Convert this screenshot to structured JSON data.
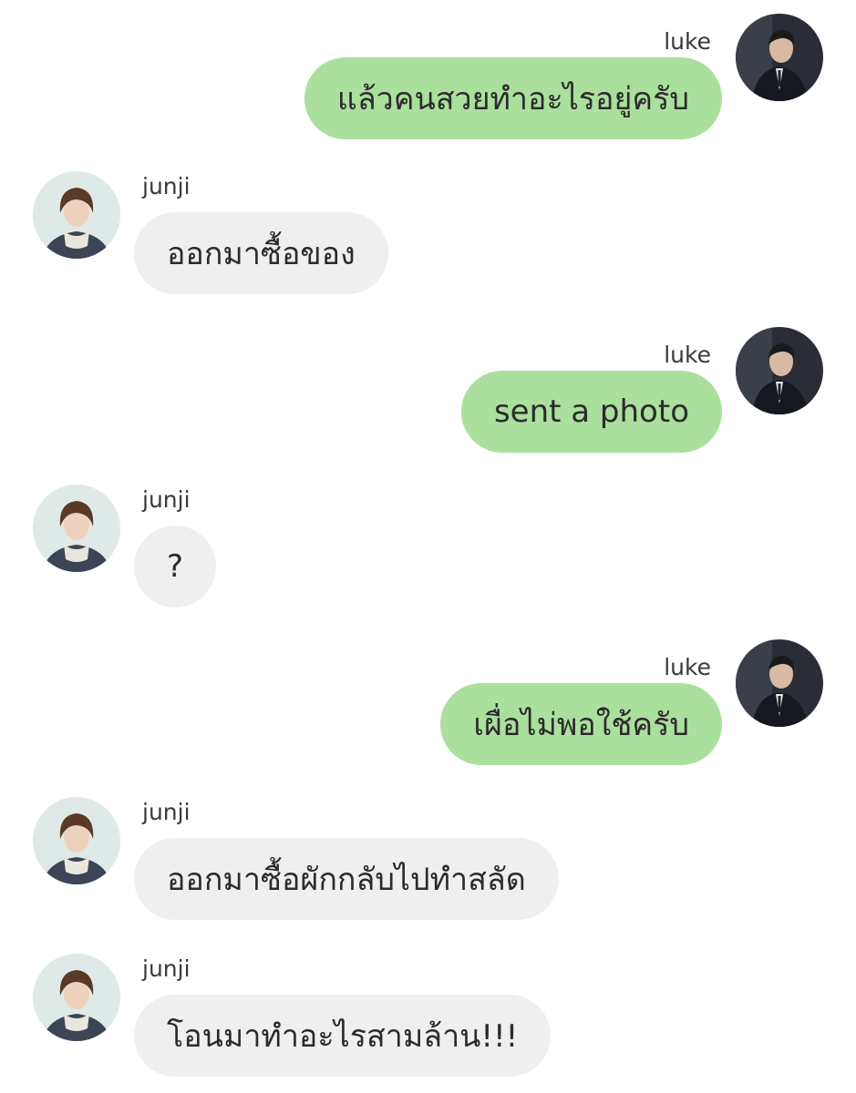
{
  "messages": [
    {
      "sender": "luke",
      "direction": "outgoing",
      "text": "แล้วคนสวยทำอะไรอยู่ครับ"
    },
    {
      "sender": "junji",
      "direction": "incoming",
      "text": "ออกมาซื้อของ"
    },
    {
      "sender": "luke",
      "direction": "outgoing",
      "text": "sent a photo"
    },
    {
      "sender": "junji",
      "direction": "incoming",
      "text": "?"
    },
    {
      "sender": "luke",
      "direction": "outgoing",
      "text": "เผื่อไม่พอใช้ครับ"
    },
    {
      "sender": "junji",
      "direction": "incoming",
      "text": "ออกมาซื้อผักกลับไปทำสลัด"
    },
    {
      "sender": "junji",
      "direction": "incoming",
      "text": "โอนมาทำอะไรสามล้าน!!!"
    }
  ],
  "colors": {
    "outgoing_bubble": "#abdf9e",
    "incoming_bubble": "#efefef",
    "text": "#2b2b2b"
  }
}
